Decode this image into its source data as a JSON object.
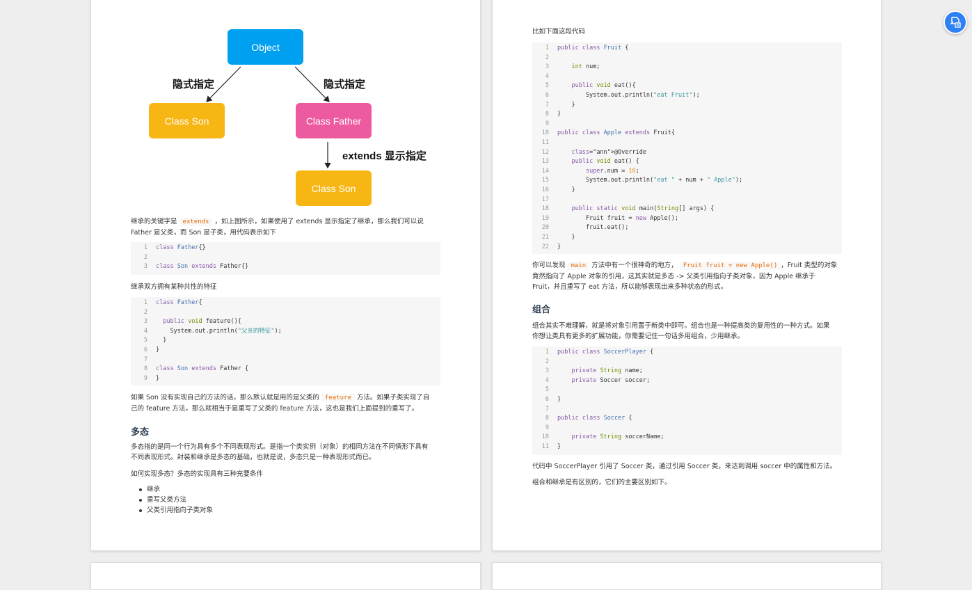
{
  "diagram": {
    "object": "Object",
    "class_son_left": "Class Son",
    "class_father": "Class Father",
    "class_son_bottom": "Class Son",
    "label_implicit_left": "隐式指定",
    "label_implicit_right": "隐式指定",
    "label_extends": "extends 显示指定",
    "colors": {
      "object": "#00a0f0",
      "son": "#f7b613",
      "father": "#ee5aa0"
    }
  },
  "left": {
    "p1": {
      "a": "继承的关键字是",
      "code": "extends",
      "b": "，如上图所示，如果使用了 extends 显示指定了继承，那么我们可以说",
      "line2": "Father 是父类，而 Son 是子类，用代码表示如下"
    },
    "code1": [
      {
        "n": "1",
        "t": "class Father{}"
      },
      {
        "n": "2",
        "t": ""
      },
      {
        "n": "3",
        "t": "class Son extends Father{}"
      }
    ],
    "p2": "继承双方拥有某种共性的特征",
    "code2": [
      {
        "n": "1",
        "t": "class Father{"
      },
      {
        "n": "2",
        "t": ""
      },
      {
        "n": "3",
        "t": "  public void feature(){"
      },
      {
        "n": "4",
        "t": "    System.out.println(\"父亲的特征\");"
      },
      {
        "n": "5",
        "t": "  }"
      },
      {
        "n": "6",
        "t": "}"
      },
      {
        "n": "7",
        "t": ""
      },
      {
        "n": "8",
        "t": "class Son extends Father {"
      },
      {
        "n": "9",
        "t": "}"
      }
    ],
    "p3": {
      "a": "如果 Son 没有实现自己的方法的话，那么默认就是用的是父类的",
      "code": "feature",
      "b": "方法。如果子类实现了自",
      "line2": "己的 feature 方法，那么就相当于是重写了父类的 feature 方法，这也是我们上面提到的重写了。"
    },
    "h_poly": "多态",
    "p4": {
      "line1": "多态指的是同一个行为具有多个不同表现形式。是指一个类实例（对象）的相同方法在不同情形下具有",
      "line2": "不同表现形式。封装和继承是多态的基础，也就是说，多态只是一种表现形式而已。"
    },
    "p5": "如何实现多态？多态的实现具有三种充要条件",
    "bullets": [
      "继承",
      "重写父类方法",
      "父类引用指向子类对象"
    ]
  },
  "right": {
    "p1": "比如下面这段代码",
    "code1": [
      {
        "n": "1",
        "t": "public class Fruit {"
      },
      {
        "n": "2",
        "t": ""
      },
      {
        "n": "3",
        "t": "    int num;"
      },
      {
        "n": "4",
        "t": ""
      },
      {
        "n": "5",
        "t": "    public void eat(){"
      },
      {
        "n": "6",
        "t": "        System.out.println(\"eat Fruit\");"
      },
      {
        "n": "7",
        "t": "    }"
      },
      {
        "n": "8",
        "t": "}"
      },
      {
        "n": "9",
        "t": ""
      },
      {
        "n": "10",
        "t": "public class Apple extends Fruit{"
      },
      {
        "n": "11",
        "t": ""
      },
      {
        "n": "12",
        "t": "    @Override"
      },
      {
        "n": "13",
        "t": "    public void eat() {"
      },
      {
        "n": "14",
        "t": "        super.num = 10;"
      },
      {
        "n": "15",
        "t": "        System.out.println(\"eat \" + num + \" Apple\");"
      },
      {
        "n": "16",
        "t": "    }"
      },
      {
        "n": "17",
        "t": ""
      },
      {
        "n": "18",
        "t": "    public static void main(String[] args) {"
      },
      {
        "n": "19",
        "t": "        Fruit fruit = new Apple();"
      },
      {
        "n": "20",
        "t": "        fruit.eat();"
      },
      {
        "n": "21",
        "t": "    }"
      },
      {
        "n": "22",
        "t": "}"
      }
    ],
    "p2": {
      "a": "你可以发现",
      "code1": "main",
      "b": "方法中有一个很神奇的地方，",
      "code2": "Fruit fruit = new Apple()",
      "c": "，Fruit 类型的对象",
      "line2": "竟然指向了 Apple 对象的引用，这其实就是多态 -> 父类引用指向子类对象，因为 Apple 继承于",
      "line3": "Fruit，并且重写了 eat 方法，所以能够表现出来多种状态的形式。"
    },
    "h_comp": "组合",
    "p3": {
      "line1": "组合其实不难理解，就是将对象引用置于新类中即可。组合也是一种提高类的复用性的一种方式。如果",
      "line2": "你想让类具有更多的扩展功能，你需要记住一句话多用组合，少用继承。"
    },
    "code2": [
      {
        "n": "1",
        "t": "public class SoccerPlayer {"
      },
      {
        "n": "2",
        "t": ""
      },
      {
        "n": "3",
        "t": "    private String name;"
      },
      {
        "n": "4",
        "t": "    private Soccer soccer;"
      },
      {
        "n": "5",
        "t": ""
      },
      {
        "n": "6",
        "t": "}"
      },
      {
        "n": "7",
        "t": ""
      },
      {
        "n": "8",
        "t": "public class Soccer {"
      },
      {
        "n": "9",
        "t": ""
      },
      {
        "n": "10",
        "t": "    private String soccerName;"
      },
      {
        "n": "11",
        "t": "}"
      }
    ],
    "p4": "代码中 SoccerPlayer 引用了 Soccer 类，通过引用 Soccer 类，来达到调用 soccer 中的属性和方法。",
    "p5": "组合和继承是有区别的，它们的主要区别如下。"
  },
  "float_button": {
    "icon": "translate-doc-icon",
    "color": "#2f7ff5"
  }
}
